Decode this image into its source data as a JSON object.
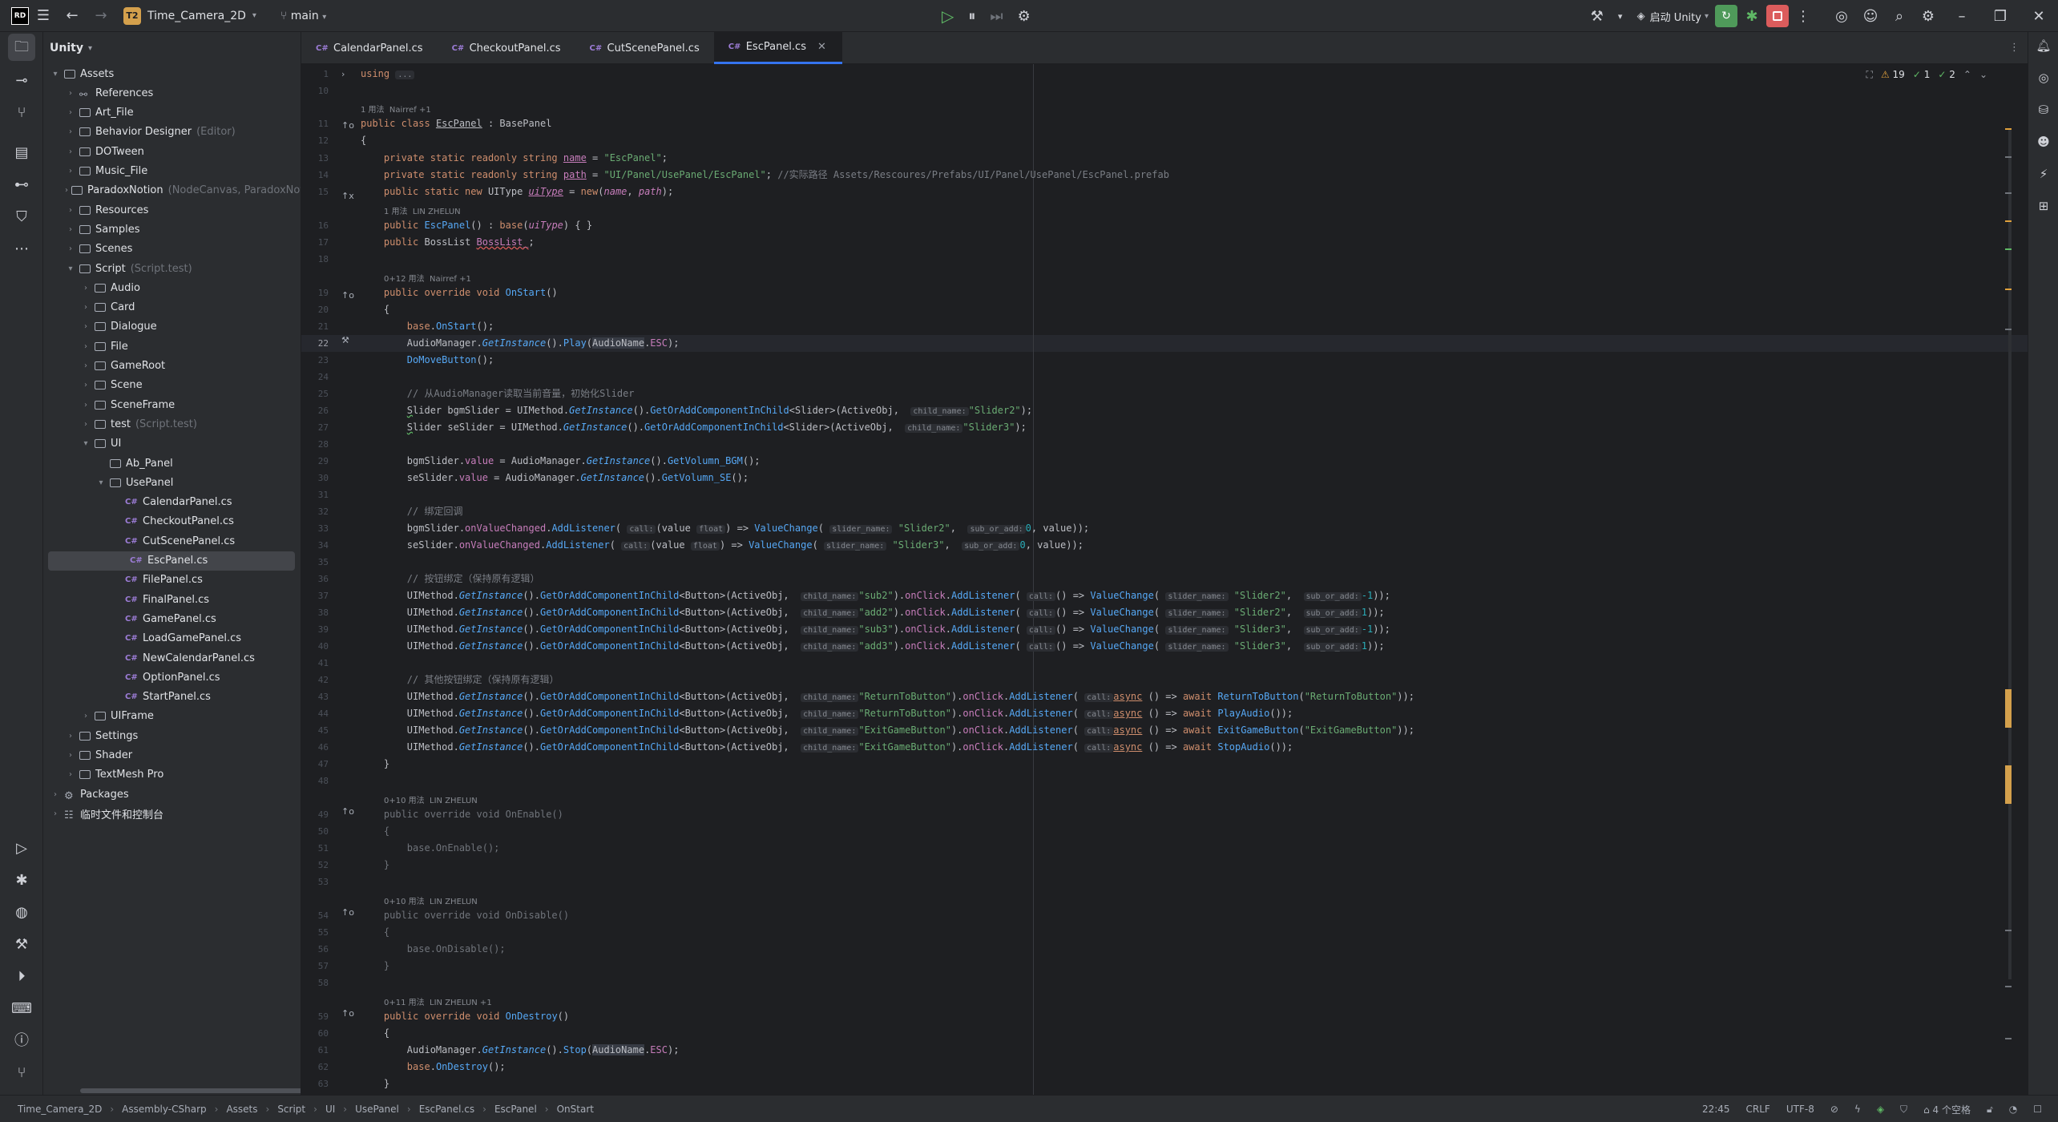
{
  "titlebar": {
    "logo": "RD",
    "project_badge": "T2",
    "project_name": "Time_Camera_2D",
    "branch": "main",
    "unity_label": "启动 Unity"
  },
  "project_panel": {
    "title": "Unity",
    "tree": [
      {
        "label": "Assets",
        "hint": "",
        "kind": "folder",
        "depth": 0,
        "arrow": "▾"
      },
      {
        "label": "References",
        "hint": "",
        "kind": "ref",
        "depth": 1,
        "arrow": "›"
      },
      {
        "label": "Art_File",
        "hint": "",
        "kind": "folder",
        "depth": 1,
        "arrow": "›"
      },
      {
        "label": "Behavior Designer",
        "hint": "(Editor)",
        "kind": "folder",
        "depth": 1,
        "arrow": "›"
      },
      {
        "label": "DOTween",
        "hint": "",
        "kind": "folder",
        "depth": 1,
        "arrow": "›"
      },
      {
        "label": "Music_File",
        "hint": "",
        "kind": "folder",
        "depth": 1,
        "arrow": "›"
      },
      {
        "label": "ParadoxNotion",
        "hint": "(NodeCanvas, ParadoxNotic",
        "kind": "folder",
        "depth": 1,
        "arrow": "›"
      },
      {
        "label": "Resources",
        "hint": "",
        "kind": "folder",
        "depth": 1,
        "arrow": "›"
      },
      {
        "label": "Samples",
        "hint": "",
        "kind": "folder",
        "depth": 1,
        "arrow": "›"
      },
      {
        "label": "Scenes",
        "hint": "",
        "kind": "folder",
        "depth": 1,
        "arrow": "›"
      },
      {
        "label": "Script",
        "hint": "(Script.test)",
        "kind": "folder",
        "depth": 1,
        "arrow": "▾"
      },
      {
        "label": "Audio",
        "hint": "",
        "kind": "folder",
        "depth": 2,
        "arrow": "›"
      },
      {
        "label": "Card",
        "hint": "",
        "kind": "folder",
        "depth": 2,
        "arrow": "›"
      },
      {
        "label": "Dialogue",
        "hint": "",
        "kind": "folder",
        "depth": 2,
        "arrow": "›"
      },
      {
        "label": "File",
        "hint": "",
        "kind": "folder",
        "depth": 2,
        "arrow": "›"
      },
      {
        "label": "GameRoot",
        "hint": "",
        "kind": "folder",
        "depth": 2,
        "arrow": "›"
      },
      {
        "label": "Scene",
        "hint": "",
        "kind": "folder",
        "depth": 2,
        "arrow": "›"
      },
      {
        "label": "SceneFrame",
        "hint": "",
        "kind": "folder",
        "depth": 2,
        "arrow": "›"
      },
      {
        "label": "test",
        "hint": "(Script.test)",
        "kind": "folder",
        "depth": 2,
        "arrow": "›"
      },
      {
        "label": "UI",
        "hint": "",
        "kind": "folder",
        "depth": 2,
        "arrow": "▾"
      },
      {
        "label": "Ab_Panel",
        "hint": "",
        "kind": "folder",
        "depth": 3,
        "arrow": ""
      },
      {
        "label": "UsePanel",
        "hint": "",
        "kind": "folder",
        "depth": 3,
        "arrow": "▾"
      },
      {
        "label": "CalendarPanel.cs",
        "hint": "",
        "kind": "cs",
        "depth": 4,
        "arrow": ""
      },
      {
        "label": "CheckoutPanel.cs",
        "hint": "",
        "kind": "cs",
        "depth": 4,
        "arrow": ""
      },
      {
        "label": "CutScenePanel.cs",
        "hint": "",
        "kind": "cs",
        "depth": 4,
        "arrow": ""
      },
      {
        "label": "EscPanel.cs",
        "hint": "",
        "kind": "cs",
        "depth": 4,
        "arrow": "",
        "selected": true
      },
      {
        "label": "FilePanel.cs",
        "hint": "",
        "kind": "cs",
        "depth": 4,
        "arrow": ""
      },
      {
        "label": "FinalPanel.cs",
        "hint": "",
        "kind": "cs",
        "depth": 4,
        "arrow": ""
      },
      {
        "label": "GamePanel.cs",
        "hint": "",
        "kind": "cs",
        "depth": 4,
        "arrow": ""
      },
      {
        "label": "LoadGamePanel.cs",
        "hint": "",
        "kind": "cs",
        "depth": 4,
        "arrow": ""
      },
      {
        "label": "NewCalendarPanel.cs",
        "hint": "",
        "kind": "cs",
        "depth": 4,
        "arrow": ""
      },
      {
        "label": "OptionPanel.cs",
        "hint": "",
        "kind": "cs",
        "depth": 4,
        "arrow": ""
      },
      {
        "label": "StartPanel.cs",
        "hint": "",
        "kind": "cs",
        "depth": 4,
        "arrow": ""
      },
      {
        "label": "UIFrame",
        "hint": "",
        "kind": "folder",
        "depth": 2,
        "arrow": "›"
      },
      {
        "label": "Settings",
        "hint": "",
        "kind": "folder",
        "depth": 1,
        "arrow": "›"
      },
      {
        "label": "Shader",
        "hint": "",
        "kind": "folder",
        "depth": 1,
        "arrow": "›"
      },
      {
        "label": "TextMesh Pro",
        "hint": "",
        "kind": "folder",
        "depth": 1,
        "arrow": "›"
      },
      {
        "label": "Packages",
        "hint": "",
        "kind": "pkg",
        "depth": 0,
        "arrow": "›"
      },
      {
        "label": "临时文件和控制台",
        "hint": "",
        "kind": "scratch",
        "depth": 0,
        "arrow": "›"
      }
    ]
  },
  "tabs": [
    {
      "prefix": "C#",
      "label": "CalendarPanel.cs",
      "active": false
    },
    {
      "prefix": "C#",
      "label": "CheckoutPanel.cs",
      "active": false
    },
    {
      "prefix": "C#",
      "label": "CutScenePanel.cs",
      "active": false
    },
    {
      "prefix": "C#",
      "label": "EscPanel.cs",
      "active": true
    }
  ],
  "editor": {
    "inspection": {
      "warnings": "19",
      "weak": "1",
      "ok": "2"
    },
    "line_numbers": [
      "1",
      "10",
      "",
      "11",
      "12",
      "13",
      "14",
      "15",
      "",
      "16",
      "17",
      "18",
      "",
      "19",
      "20",
      "21",
      "22",
      "23",
      "24",
      "25",
      "26",
      "27",
      "28",
      "29",
      "30",
      "31",
      "32",
      "33",
      "34",
      "35",
      "36",
      "37",
      "38",
      "39",
      "40",
      "41",
      "42",
      "43",
      "44",
      "45",
      "46",
      "47",
      "48",
      "",
      "49",
      "50",
      "51",
      "52",
      "53",
      "",
      "54",
      "55",
      "56",
      "57",
      "58",
      "",
      "59",
      "60",
      "61",
      "62",
      "63"
    ],
    "current_line": "22",
    "inlays": {
      "usage_1": "1 用法",
      "author_1": "Nairref +1",
      "usage_2": "1 用法",
      "author_2": "LIN ZHELUN",
      "usage_3": "0+12 用法",
      "author_3": "Nairref +1",
      "usage_4": "0+10 用法",
      "author_4": "LIN ZHELUN",
      "usage_5": "0+10 用法",
      "author_5": "LIN ZHELUN",
      "usage_6": "0+11 用法",
      "author_6": "LIN ZHELUN +1"
    }
  },
  "statusbar": {
    "crumbs": [
      "Time_Camera_2D",
      "Assembly-CSharp",
      "Assets",
      "Script",
      "UI",
      "UsePanel",
      "EscPanel.cs",
      "EscPanel",
      "OnStart"
    ],
    "position": "22:45",
    "line_ending": "CRLF",
    "encoding": "UTF-8",
    "indent": "4 个空格"
  }
}
